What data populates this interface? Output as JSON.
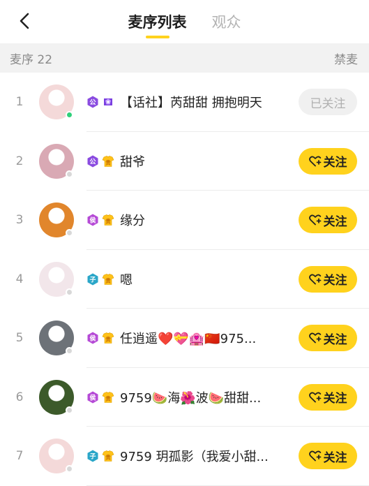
{
  "header": {
    "tabs": [
      {
        "label": "麦序列表",
        "active": true
      },
      {
        "label": "观众",
        "active": false
      }
    ],
    "accent_color": "#ffd21d"
  },
  "subbar": {
    "left_label": "麦序 22",
    "right_label": "禁麦"
  },
  "rows": [
    {
      "index": "1",
      "name": "【话社】芮甜甜 拥抱明天",
      "button": "已关注",
      "followed": true,
      "online": true,
      "badge1": "公",
      "badge1_color": "#8a4be0",
      "badge2": "crown",
      "avatar_color": "#f4d9d9"
    },
    {
      "index": "2",
      "name": "甜爷",
      "button": "关注",
      "followed": false,
      "online": false,
      "badge1": "公",
      "badge1_color": "#8a4be0",
      "badge2": "shirt",
      "avatar_color": "#d9a9b4"
    },
    {
      "index": "3",
      "name": "缘分",
      "button": "关注",
      "followed": false,
      "online": false,
      "badge1": "侯",
      "badge1_color": "#b54ad6",
      "badge2": "shirt",
      "avatar_color": "#e1862c"
    },
    {
      "index": "4",
      "name": "嗯",
      "button": "关注",
      "followed": false,
      "online": false,
      "badge1": "子",
      "badge1_color": "#2aa6c8",
      "badge2": "shirt",
      "avatar_color": "#f2e6ea"
    },
    {
      "index": "5",
      "name": "任逍遥❤️💝🏩🇨🇳975...",
      "button": "关注",
      "followed": false,
      "online": false,
      "badge1": "侯",
      "badge1_color": "#b54ad6",
      "badge2": "shirt",
      "avatar_color": "#6d7278"
    },
    {
      "index": "6",
      "name": "9759🍉海🌺波🍉甜甜...",
      "button": "关注",
      "followed": false,
      "online": false,
      "badge1": "侯",
      "badge1_color": "#b54ad6",
      "badge2": "shirt",
      "avatar_color": "#3c5a2a"
    },
    {
      "index": "7",
      "name": "9759 玥孤影（我爱小甜...",
      "button": "关注",
      "followed": false,
      "online": false,
      "badge1": "子",
      "badge1_color": "#2aa6c8",
      "badge2": "shirt",
      "avatar_color": "#f4d9d9"
    }
  ]
}
